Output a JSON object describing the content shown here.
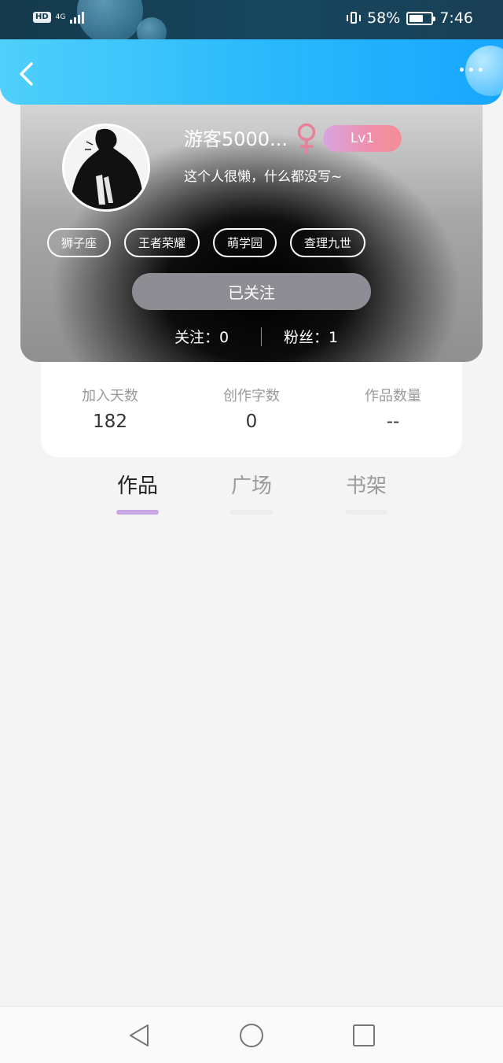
{
  "status_bar": {
    "hd_label": "HD",
    "network": "4G",
    "battery": "58%",
    "time": "7:46"
  },
  "header": {
    "back_icon": "chevron-left-icon",
    "more_icon": "more-dots-icon"
  },
  "profile": {
    "username": "游客5000...",
    "gender_icon": "female-icon",
    "level": "Lv1",
    "bio": "这个人很懒，什么都没写~",
    "tags": [
      "狮子座",
      "王者荣耀",
      "萌学园",
      "查理九世"
    ],
    "follow_button_label": "已关注",
    "following_label": "关注：0",
    "fans_label": "粉丝：1"
  },
  "stats": [
    {
      "label": "加入天数",
      "value": "182"
    },
    {
      "label": "创作字数",
      "value": "0"
    },
    {
      "label": "作品数量",
      "value": "--"
    }
  ],
  "tabs": [
    {
      "label": "作品",
      "active": true
    },
    {
      "label": "广场",
      "active": false
    },
    {
      "label": "书架",
      "active": false
    }
  ],
  "nav_bar": {
    "back_icon": "nav-back-triangle-icon",
    "home_icon": "nav-home-circle-icon",
    "recents_icon": "nav-recents-square-icon"
  },
  "colors": {
    "header_gradient_start": "#4fd0fb",
    "header_gradient_end": "#18a6ff",
    "level_badge_gradient": [
      "#d8a5e0",
      "#f48d95"
    ],
    "female_icon": "#e7819a",
    "follow_button": "#8e8d94",
    "active_tab_underline": "#c9a8e6"
  }
}
